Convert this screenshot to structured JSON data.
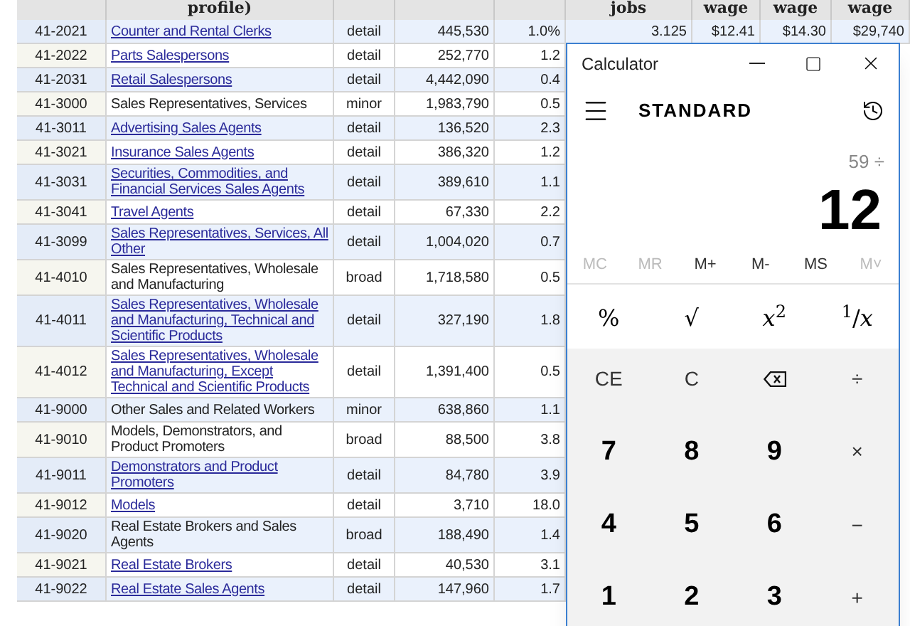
{
  "table": {
    "header": [
      "profile)",
      "jobs",
      "wage",
      "wage",
      "wage"
    ],
    "rows": [
      {
        "code": "41-2021",
        "title": "Counter and Rental Clerks",
        "link": true,
        "level": "detail",
        "employment": "445,530",
        "rse": "1.0%",
        "jobs": "3.125",
        "wage1": "$12.41",
        "wage2": "$14.30",
        "wage3": "$29,740"
      },
      {
        "code": "41-2022",
        "title": "Parts Salespersons",
        "link": true,
        "level": "detail",
        "employment": "252,770",
        "rse": "1.2"
      },
      {
        "code": "41-2031",
        "title": "Retail Salespersons",
        "link": true,
        "level": "detail",
        "employment": "4,442,090",
        "rse": "0.4"
      },
      {
        "code": "41-3000",
        "title": "Sales Representatives, Services",
        "link": false,
        "level": "minor",
        "employment": "1,983,790",
        "rse": "0.5"
      },
      {
        "code": "41-3011",
        "title": "Advertising Sales Agents",
        "link": true,
        "level": "detail",
        "employment": "136,520",
        "rse": "2.3"
      },
      {
        "code": "41-3021",
        "title": "Insurance Sales Agents",
        "link": true,
        "level": "detail",
        "employment": "386,320",
        "rse": "1.2"
      },
      {
        "code": "41-3031",
        "title": "Securities, Commodities, and Financial Services Sales Agents",
        "link": true,
        "level": "detail",
        "employment": "389,610",
        "rse": "1.1"
      },
      {
        "code": "41-3041",
        "title": "Travel Agents",
        "link": true,
        "level": "detail",
        "employment": "67,330",
        "rse": "2.2"
      },
      {
        "code": "41-3099",
        "title": "Sales Representatives, Services, All Other",
        "link": true,
        "level": "detail",
        "employment": "1,004,020",
        "rse": "0.7"
      },
      {
        "code": "41-4010",
        "title": "Sales Representatives, Wholesale and Manufacturing",
        "link": false,
        "level": "broad",
        "employment": "1,718,580",
        "rse": "0.5"
      },
      {
        "code": "41-4011",
        "title": "Sales Representatives, Wholesale and Manufacturing, Technical and Scientific Products",
        "link": true,
        "level": "detail",
        "employment": "327,190",
        "rse": "1.8"
      },
      {
        "code": "41-4012",
        "title": "Sales Representatives, Wholesale and Manufacturing, Except Technical and Scientific Products",
        "link": true,
        "level": "detail",
        "employment": "1,391,400",
        "rse": "0.5"
      },
      {
        "code": "41-9000",
        "title": "Other Sales and Related Workers",
        "link": false,
        "level": "minor",
        "employment": "638,860",
        "rse": "1.1"
      },
      {
        "code": "41-9010",
        "title": "Models, Demonstrators, and Product Promoters",
        "link": false,
        "level": "broad",
        "employment": "88,500",
        "rse": "3.8"
      },
      {
        "code": "41-9011",
        "title": "Demonstrators and Product Promoters",
        "link": true,
        "level": "detail",
        "employment": "84,780",
        "rse": "3.9"
      },
      {
        "code": "41-9012",
        "title": "Models",
        "link": true,
        "level": "detail",
        "employment": "3,710",
        "rse": "18.0"
      },
      {
        "code": "41-9020",
        "title": "Real Estate Brokers and Sales Agents",
        "link": false,
        "level": "broad",
        "employment": "188,490",
        "rse": "1.4"
      },
      {
        "code": "41-9021",
        "title": "Real Estate Brokers",
        "link": true,
        "level": "detail",
        "employment": "40,530",
        "rse": "3.1"
      },
      {
        "code": "41-9022",
        "title": "Real Estate Sales Agents",
        "link": true,
        "level": "detail",
        "employment": "147,960",
        "rse": "1.7"
      }
    ]
  },
  "calculator": {
    "title": "Calculator",
    "mode": "STANDARD",
    "expression": "59 ÷",
    "display": "12",
    "memory": [
      {
        "label": "MC",
        "disabled": true
      },
      {
        "label": "MR",
        "disabled": true
      },
      {
        "label": "M+",
        "disabled": false
      },
      {
        "label": "M-",
        "disabled": false
      },
      {
        "label": "MS",
        "disabled": false
      },
      {
        "label": "M˅",
        "disabled": true
      }
    ],
    "keys": [
      {
        "label": "%",
        "kind": "func"
      },
      {
        "label": "√",
        "kind": "func"
      },
      {
        "label": "*x*$^{2}$",
        "kind": "func"
      },
      {
        "label": "$^{1}$/*x*",
        "kind": "func"
      },
      {
        "label": "CE",
        "kind": "op"
      },
      {
        "label": "C",
        "kind": "op"
      },
      {
        "kind": "backspace"
      },
      {
        "label": "÷",
        "kind": "op"
      },
      {
        "label": "7",
        "kind": "digit"
      },
      {
        "label": "8",
        "kind": "digit"
      },
      {
        "label": "9",
        "kind": "digit"
      },
      {
        "label": "×",
        "kind": "op"
      },
      {
        "label": "4",
        "kind": "digit"
      },
      {
        "label": "5",
        "kind": "digit"
      },
      {
        "label": "6",
        "kind": "digit"
      },
      {
        "label": "−",
        "kind": "op"
      },
      {
        "label": "1",
        "kind": "digit"
      },
      {
        "label": "2",
        "kind": "digit"
      },
      {
        "label": "3",
        "kind": "digit"
      },
      {
        "label": "+",
        "kind": "op"
      }
    ]
  }
}
